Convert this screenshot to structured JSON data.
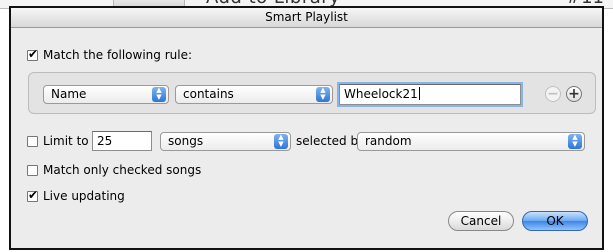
{
  "background_window": {
    "library_text": "Add to Library",
    "number_text": "#11"
  },
  "dialog": {
    "title": "Smart Playlist",
    "match_rule": {
      "label": "Match the following rule:",
      "checked": true
    },
    "rule": {
      "field": "Name",
      "operator": "contains",
      "value": "Wheelock21",
      "remove_icon": "minus-circle",
      "add_icon": "plus-circle"
    },
    "limit": {
      "label": "Limit to",
      "checked": false,
      "count": "25",
      "unit": "songs",
      "selected_by_label": "selected by",
      "selected_by": "random"
    },
    "match_checked": {
      "label": "Match only checked songs",
      "checked": false
    },
    "live_updating": {
      "label": "Live updating",
      "checked": true
    },
    "cancel_label": "Cancel",
    "ok_label": "OK",
    "colors": {
      "accent": "#3d86e6",
      "dialog_bg": "#ececec"
    }
  }
}
